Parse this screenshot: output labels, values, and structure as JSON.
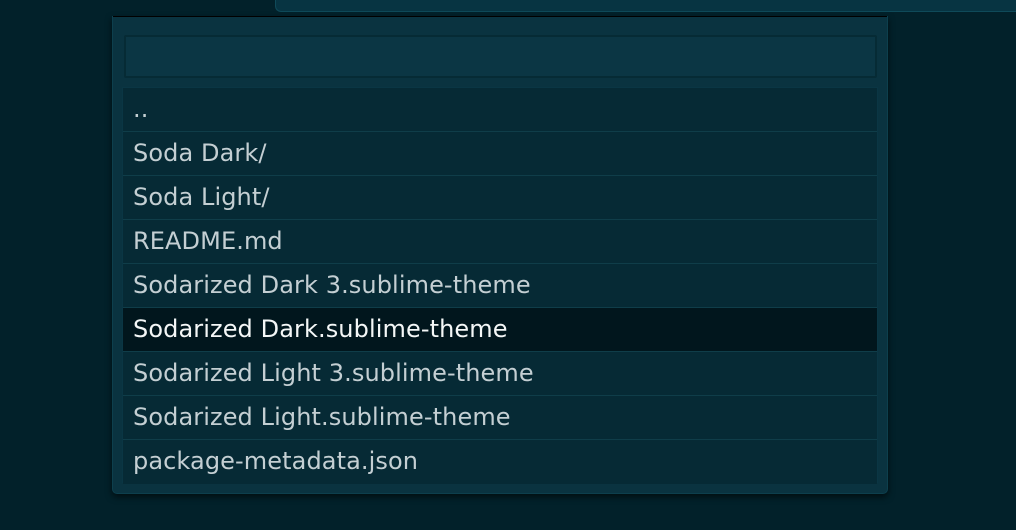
{
  "quick_panel": {
    "search": {
      "value": "",
      "placeholder": ""
    },
    "items": [
      {
        "label": ".."
      },
      {
        "label": "Soda Dark/"
      },
      {
        "label": "Soda Light/"
      },
      {
        "label": "README.md"
      },
      {
        "label": "Sodarized Dark 3.sublime-theme"
      },
      {
        "label": "Sodarized Dark.sublime-theme",
        "selected": true
      },
      {
        "label": "Sodarized Light 3.sublime-theme"
      },
      {
        "label": "Sodarized Light.sublime-theme"
      },
      {
        "label": "package-metadata.json"
      }
    ]
  },
  "colors": {
    "background": "#02212a",
    "panel": "#0a3340",
    "item_background": "#062a35",
    "selected_background": "#01161d",
    "item_text": "#c4cfd3",
    "selected_text": "#f4f7f7"
  }
}
